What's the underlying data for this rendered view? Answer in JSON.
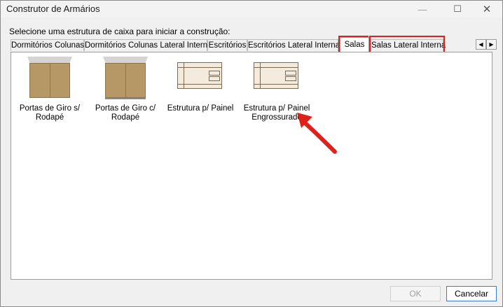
{
  "window": {
    "title": "Construtor de Armários",
    "controls": {
      "minimize": "—",
      "maximize": "☐",
      "close": "✕"
    }
  },
  "instruction": "Selecione uma estrutura de caixa para iniciar a construção:",
  "tabs": [
    {
      "label": "Dormitórios Colunas"
    },
    {
      "label": "Dormitórios Colunas Lateral Interna"
    },
    {
      "label": "Escritórios"
    },
    {
      "label": "Escritórios Lateral Interna"
    },
    {
      "label": "Salas"
    },
    {
      "label": "Salas Lateral Interna"
    }
  ],
  "active_tab": "Salas",
  "tab_scroll": {
    "left": "◀",
    "right": "▶"
  },
  "items": [
    {
      "label": "Portas de Giro s/ Rodapé",
      "icon": "cabinet-icon"
    },
    {
      "label": "Portas de Giro c/ Rodapé",
      "icon": "cabinet-icon"
    },
    {
      "label": "Estrutura p/ Painel",
      "icon": "panel-structure-icon"
    },
    {
      "label": "Estrutura p/ Painel Engrossurado",
      "icon": "panel-structure-icon"
    }
  ],
  "buttons": {
    "ok": "OK",
    "cancel": "Cancelar"
  },
  "colors": {
    "highlight": "#e0201b",
    "arrow": "#e0201b",
    "wood": "#b69766",
    "panel": "#f5ebdc"
  }
}
